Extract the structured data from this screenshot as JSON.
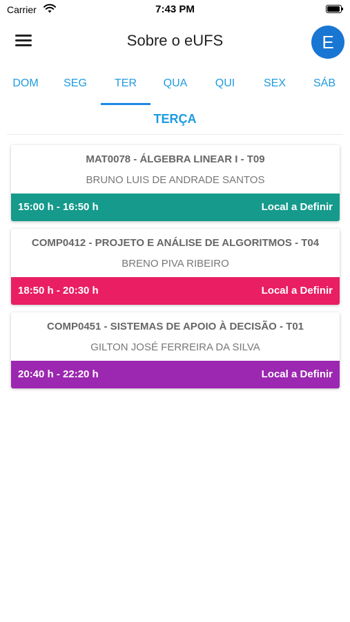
{
  "status_bar": {
    "carrier": "Carrier",
    "time": "7:43 PM",
    "wifi_icon": "wifi-icon",
    "battery_icon": "battery-icon"
  },
  "app_bar": {
    "title": "Sobre o eUFS",
    "menu_icon": "hamburger-menu-icon",
    "avatar_letter": "E"
  },
  "tabs": [
    {
      "label": "DOM"
    },
    {
      "label": "SEG"
    },
    {
      "label": "TER",
      "selected": true
    },
    {
      "label": "QUA"
    },
    {
      "label": "QUI"
    },
    {
      "label": "SEX"
    },
    {
      "label": "SÁB"
    }
  ],
  "day_heading": "TERÇA",
  "classes": [
    {
      "title": "MAT0078 - ÁLGEBRA LINEAR I - T09",
      "teacher": "BRUNO LUIS DE ANDRADE SANTOS",
      "time": "15:00 h - 16:50 h",
      "location": "Local a Definir",
      "color": "#159a8c"
    },
    {
      "title": "COMP0412 - PROJETO E ANÁLISE DE ALGORITMOS - T04",
      "teacher": "BRENO PIVA RIBEIRO",
      "time": "18:50 h - 20:30 h",
      "location": "Local a Definir",
      "color": "#e91e63"
    },
    {
      "title": "COMP0451 - SISTEMAS DE APOIO À DECISÃO - T01",
      "teacher": "GILTON JOSÉ FERREIRA DA SILVA",
      "time": "20:40 h - 22:20 h",
      "location": "Local a Definir",
      "color": "#9c27b0"
    }
  ],
  "colors": {
    "accent": "#1e9be0",
    "avatar": "#1976d2"
  }
}
